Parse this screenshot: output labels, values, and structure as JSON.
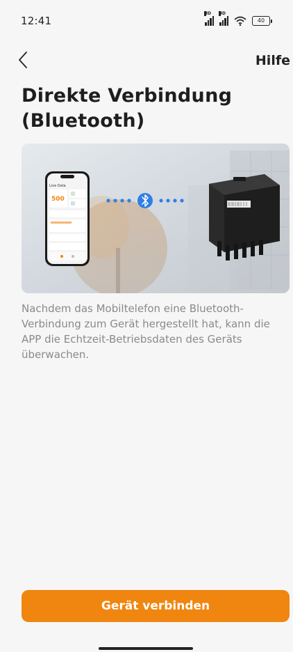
{
  "status_bar": {
    "time": "12:41",
    "signal_label": "HD",
    "battery_level": "40"
  },
  "nav": {
    "back_icon": "chevron-left-icon",
    "help_label": "Hilfe"
  },
  "page": {
    "title": "Direkte Verbindung (Bluetooth)",
    "description": "Nachdem das Mobiltelefon eine Bluetooth-Verbindung zum Gerät hergestellt hat, kann die APP die Echtzeit-Betriebsdaten des Geräts überwachen."
  },
  "illustration": {
    "phone_screen": {
      "header": "Live Data",
      "power_value": "500"
    },
    "connector_icon": "bluetooth-icon"
  },
  "actions": {
    "connect_label": "Gerät verbinden"
  },
  "colors": {
    "accent": "#f0860f",
    "bluetooth": "#2f7fe6",
    "background": "#f6f6f6"
  }
}
